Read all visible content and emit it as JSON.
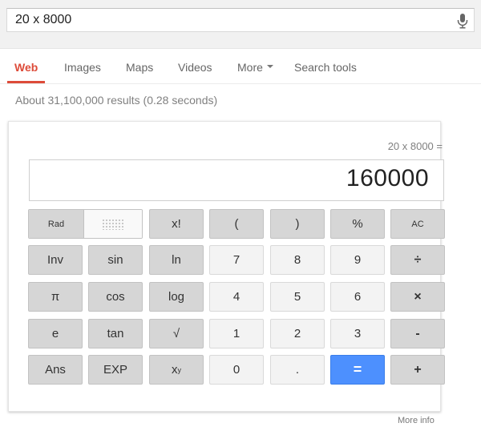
{
  "search": {
    "query": "20 x 8000",
    "mic_icon": "microphone-icon"
  },
  "tabs": [
    {
      "label": "Web",
      "active": true
    },
    {
      "label": "Images"
    },
    {
      "label": "Maps"
    },
    {
      "label": "Videos"
    },
    {
      "label": "More"
    },
    {
      "label": "Search tools"
    }
  ],
  "results_stats": "About 31,100,000 results (0.28 seconds)",
  "calculator": {
    "expression": "20 x 8000 =",
    "result": "160000",
    "toggle": {
      "rad": "Rad"
    },
    "keys": {
      "factorial": "x!",
      "open_paren": "(",
      "close_paren": ")",
      "percent": "%",
      "clear": "AC",
      "inv": "Inv",
      "sin": "sin",
      "ln": "ln",
      "seven": "7",
      "eight": "8",
      "nine": "9",
      "divide": "÷",
      "pi": "π",
      "cos": "cos",
      "log": "log",
      "four": "4",
      "five": "5",
      "six": "6",
      "multiply": "×",
      "e": "e",
      "tan": "tan",
      "sqrt": "√",
      "one": "1",
      "two": "2",
      "three": "3",
      "minus": "-",
      "ans": "Ans",
      "exp": "EXP",
      "power_base": "x",
      "power_exp": "y",
      "zero": "0",
      "dot": ".",
      "equals": "=",
      "plus": "+"
    }
  },
  "footer": {
    "more_info": "More info"
  },
  "colors": {
    "accent_red": "#dd4b39",
    "equals_blue": "#4d90fe"
  }
}
